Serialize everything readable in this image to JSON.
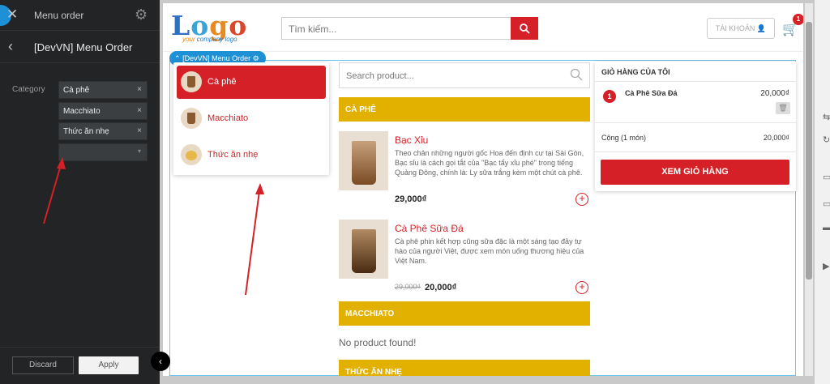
{
  "editor": {
    "title": "Menu order",
    "subtitle": "[DevVN] Menu Order",
    "category_label": "Category",
    "chips": [
      "Cà phê",
      "Macchiato",
      "Thức ăn nhẹ"
    ],
    "discard_label": "Discard",
    "apply_label": "Apply"
  },
  "header": {
    "logo_letters": [
      {
        "char": "L",
        "color": "#2f6fc2"
      },
      {
        "char": "o",
        "color": "#3aa3d8"
      },
      {
        "char": "g",
        "color": "#e88a22"
      },
      {
        "char": "o",
        "color": "#d9482a"
      }
    ],
    "logo_tag_1": "your",
    "logo_tag_2": "company logo",
    "search_placeholder": "Tìm kiếm...",
    "account_label": "TÀI KHOẢN",
    "cart_count": "1"
  },
  "widget": {
    "tag_label": "[DevVN] Menu Order"
  },
  "categories": [
    {
      "label": "Cà phê",
      "active": true,
      "icon": "coffee-cup-icon"
    },
    {
      "label": "Macchiato",
      "active": false,
      "icon": "coffee-cup-icon"
    },
    {
      "label": "Thức ăn nhẹ",
      "active": false,
      "icon": "snack-icon"
    }
  ],
  "products_panel": {
    "search_placeholder": "Search product...",
    "sections": [
      {
        "title": "CÀ PHÊ"
      },
      {
        "title": "MACCHIATO"
      },
      {
        "title": "THỨC ĂN NHẸ"
      }
    ],
    "empty_message": "No product found!",
    "items": [
      {
        "name": "Bạc Xỉu",
        "description": "Theo chân những người gốc Hoa đến định cư tại Sài Gòn, Bạc sỉu là cách gọi tắt của \"Bạc tẩy xỉu phé\" trong tiếng Quảng Đông, chính là: Ly sữa trắng kèm một chút cà phê.",
        "old_price": "",
        "price": "29,000₫"
      },
      {
        "name": "Cà Phê Sữa Đá",
        "description": "Cà phê phin kết hợp cũng sữa đặc là một sáng tạo đầy tự hào của người Việt, được xem món uống thương hiệu của Việt Nam.",
        "old_price": "29,000₫",
        "price": "20,000₫"
      }
    ]
  },
  "cart": {
    "title": "GIỎ HÀNG CỦA TÔI",
    "items": [
      {
        "qty": "1",
        "name": "Cà Phê Sữa Đá",
        "price": "20,000₫"
      }
    ],
    "total_label": "Cộng (1 món)",
    "total": "20,000₫",
    "view_label": "XEM GIỎ HÀNG"
  },
  "colors": {
    "brand_red": "#d62027",
    "section_yellow": "#e2b100",
    "editor_bg": "#222425",
    "widget_blue": "#1e90d6"
  }
}
